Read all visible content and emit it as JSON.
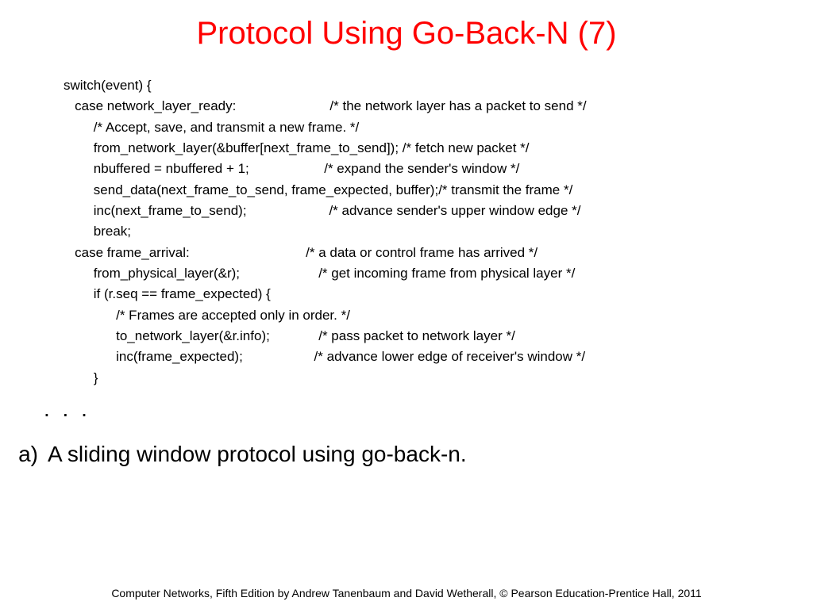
{
  "title": "Protocol Using Go-Back-N (7)",
  "code": {
    "l1": "switch(event) {",
    "l2": "   case network_layer_ready:                         /* the network layer has a packet to send */",
    "l3": "        /* Accept, save, and transmit a new frame. */",
    "l4": "        from_network_layer(&buffer[next_frame_to_send]); /* fetch new packet */",
    "l5": "        nbuffered = nbuffered + 1;                    /* expand the sender's window */",
    "l6": "        send_data(next_frame_to_send, frame_expected, buffer);/* transmit the frame */",
    "l7": "        inc(next_frame_to_send);                      /* advance sender's upper window edge */",
    "l8": "        break;",
    "l9": "",
    "l10": "   case frame_arrival:                               /* a data or control frame has arrived */",
    "l11": "        from_physical_layer(&r);                     /* get incoming frame from physical layer */",
    "l12": "",
    "l13": "        if (r.seq == frame_expected) {",
    "l14": "              /* Frames are accepted only in order. */",
    "l15": "              to_network_layer(&r.info);             /* pass packet to network layer */",
    "l16": "              inc(frame_expected);                   /* advance lower edge of receiver's window */",
    "l17": "        }"
  },
  "ellipsis": ". . .",
  "caption": {
    "label": "a)",
    "text": "A sliding window protocol using go-back-n."
  },
  "footer": "Computer Networks, Fifth Edition by Andrew Tanenbaum and David Wetherall, © Pearson Education-Prentice Hall, 2011"
}
